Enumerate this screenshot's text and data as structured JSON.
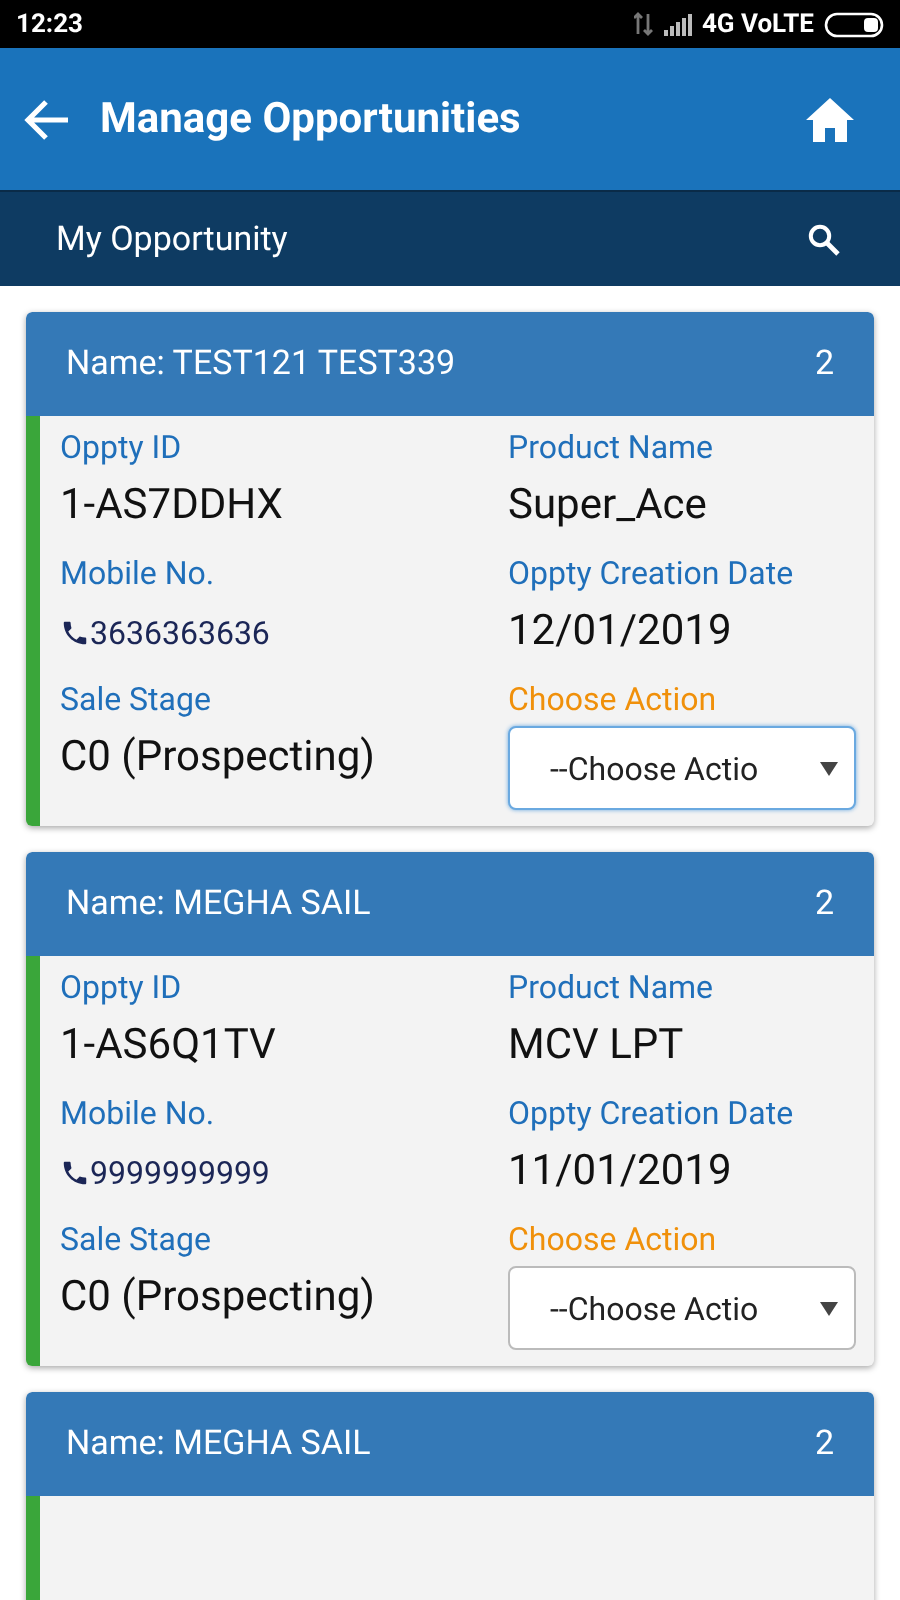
{
  "status_bar": {
    "time": "12:23",
    "network": "4G VoLTE"
  },
  "app_bar": {
    "title": "Manage Opportunities"
  },
  "sub_bar": {
    "title": "My Opportunity"
  },
  "opportunities": [
    {
      "name": "Name: TEST121 TEST339",
      "count": "2",
      "fields": [
        {
          "kind": "text",
          "label": "Oppty ID",
          "value": "1-AS7DDHX"
        },
        {
          "kind": "text",
          "label": "Product Name",
          "value": "Super_Ace"
        },
        {
          "kind": "phone",
          "label": "Mobile No.",
          "value": "3636363636"
        },
        {
          "kind": "text",
          "label": "Oppty Creation Date",
          "value": "12/01/2019"
        },
        {
          "kind": "text",
          "label": "Sale Stage",
          "value": "C0 (Prospecting)"
        },
        {
          "kind": "select",
          "label": "Choose Action",
          "value": "--Choose Actio",
          "focused": true
        }
      ]
    },
    {
      "name": "Name: MEGHA SAIL",
      "count": "2",
      "fields": [
        {
          "kind": "text",
          "label": "Oppty ID",
          "value": "1-AS6Q1TV"
        },
        {
          "kind": "text",
          "label": "Product Name",
          "value": "MCV LPT"
        },
        {
          "kind": "phone",
          "label": "Mobile No.",
          "value": "9999999999"
        },
        {
          "kind": "text",
          "label": "Oppty Creation Date",
          "value": "11/01/2019"
        },
        {
          "kind": "text",
          "label": "Sale Stage",
          "value": "C0 (Prospecting)"
        },
        {
          "kind": "select",
          "label": "Choose Action",
          "value": "--Choose Actio",
          "focused": false
        }
      ]
    },
    {
      "name": "Name: MEGHA SAIL",
      "count": "2"
    }
  ]
}
